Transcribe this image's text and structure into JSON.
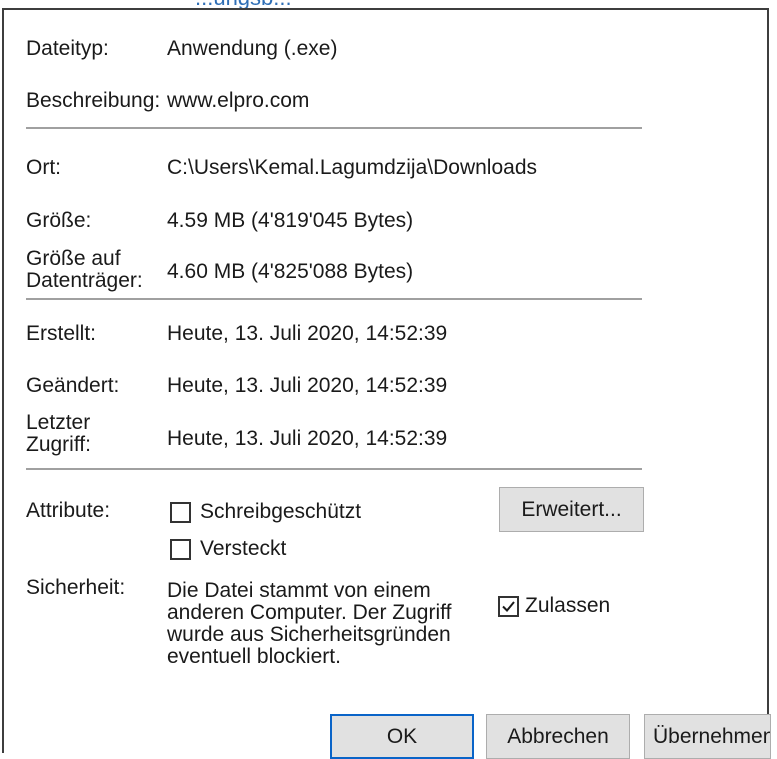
{
  "window": {
    "top_text": "...ungsb..."
  },
  "general": {
    "file_type": {
      "label": "Dateityp:",
      "value": "Anwendung (.exe)"
    },
    "description": {
      "label": "Beschreibung:",
      "value": "www.elpro.com"
    },
    "location": {
      "label": "Ort:",
      "value": "C:\\Users\\Kemal.Lagumdzija\\Downloads"
    },
    "size": {
      "label": "Größe:",
      "value": "4.59 MB (4'819'045 Bytes)"
    },
    "size_on_disk": {
      "label_line1": "Größe auf",
      "label_line2": "Datenträger:",
      "value": "4.60 MB (4'825'088 Bytes)"
    },
    "created": {
      "label": "Erstellt:",
      "value": "Heute, 13. Juli 2020, 14:52:39"
    },
    "modified": {
      "label": "Geändert:",
      "value": "Heute, 13. Juli 2020, 14:52:39"
    },
    "accessed": {
      "label_line1": "Letzter",
      "label_line2": "Zugriff:",
      "value": "Heute, 13. Juli 2020, 14:52:39"
    }
  },
  "attributes": {
    "label": "Attribute:",
    "readonly": {
      "label": "Schreibgeschützt",
      "checked": false
    },
    "hidden": {
      "label": "Versteckt",
      "checked": false
    },
    "advanced_button": "Erweitert..."
  },
  "security": {
    "label": "Sicherheit:",
    "text_line1": "Die Datei stammt von einem",
    "text_line2": "anderen Computer. Der Zugriff",
    "text_line3": "wurde aus Sicherheitsgründen",
    "text_line4": "eventuell blockiert.",
    "unblock": {
      "label": "Zulassen",
      "checked": true
    }
  },
  "footer": {
    "ok": "OK",
    "cancel": "Abbrechen",
    "apply": "Übernehmen"
  },
  "colors": {
    "accent_focus": "#0a64c8",
    "button_bg": "#e1e1e1",
    "separator": "#a0a0a0"
  }
}
